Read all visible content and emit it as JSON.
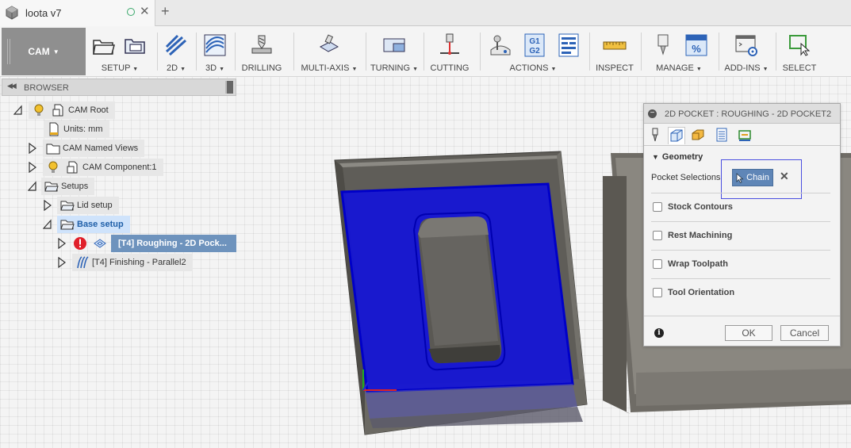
{
  "tab": {
    "title": "loota v7",
    "close": "✕",
    "add": "+"
  },
  "toolbar": {
    "workspace": "CAM",
    "groups": [
      {
        "label": "SETUP",
        "dropdown": true
      },
      {
        "label": "2D",
        "dropdown": true
      },
      {
        "label": "3D",
        "dropdown": true
      },
      {
        "label": "DRILLING",
        "dropdown": false
      },
      {
        "label": "MULTI-AXIS",
        "dropdown": true
      },
      {
        "label": "TURNING",
        "dropdown": true
      },
      {
        "label": "CUTTING",
        "dropdown": false
      },
      {
        "label": "ACTIONS",
        "dropdown": true
      },
      {
        "label": "INSPECT",
        "dropdown": false
      },
      {
        "label": "MANAGE",
        "dropdown": true
      },
      {
        "label": "ADD-INS",
        "dropdown": true
      },
      {
        "label": "SELECT",
        "dropdown": false
      }
    ],
    "actions_icon_text": {
      "g1": "G1",
      "g2": "G2"
    },
    "manage_icon_text": "%"
  },
  "browser": {
    "title": "BROWSER",
    "nodes": [
      {
        "label": "CAM Root",
        "icon": "folder-doc-icon"
      },
      {
        "label": "Units: mm",
        "icon": "document-icon"
      },
      {
        "label": "CAM Named Views",
        "icon": "folder-icon"
      },
      {
        "label": "CAM Component:1",
        "icon": "component-icon"
      },
      {
        "label": "Setups",
        "icon": "folder-open-icon"
      },
      {
        "label": "Lid setup",
        "icon": "folder-open-icon"
      },
      {
        "label": "Base setup",
        "icon": "folder-open-icon"
      },
      {
        "label": "[T4] Roughing - 2D Pock...",
        "icon": "pocket-op-icon"
      },
      {
        "label": "[T4] Finishing - Parallel2",
        "icon": "parallel-op-icon"
      }
    ]
  },
  "dialog": {
    "title": "2D POCKET : ROUGHING - 2D POCKET2",
    "section_title": "Geometry",
    "pocket_selections_label": "Pocket Selections",
    "chain_button": "Chain",
    "clear_symbol": "✕",
    "options": [
      "Stock Contours",
      "Rest Machining",
      "Wrap Toolpath",
      "Tool Orientation"
    ],
    "info_symbol": "i",
    "ok_label": "OK",
    "cancel_label": "Cancel"
  },
  "colors": {
    "selection_blue": "#1414d8",
    "selected_node": "#6e93bd",
    "workspace_bg": "#8f8f8f",
    "error_red": "#e0202a",
    "chain_button": "#5f86b7"
  }
}
